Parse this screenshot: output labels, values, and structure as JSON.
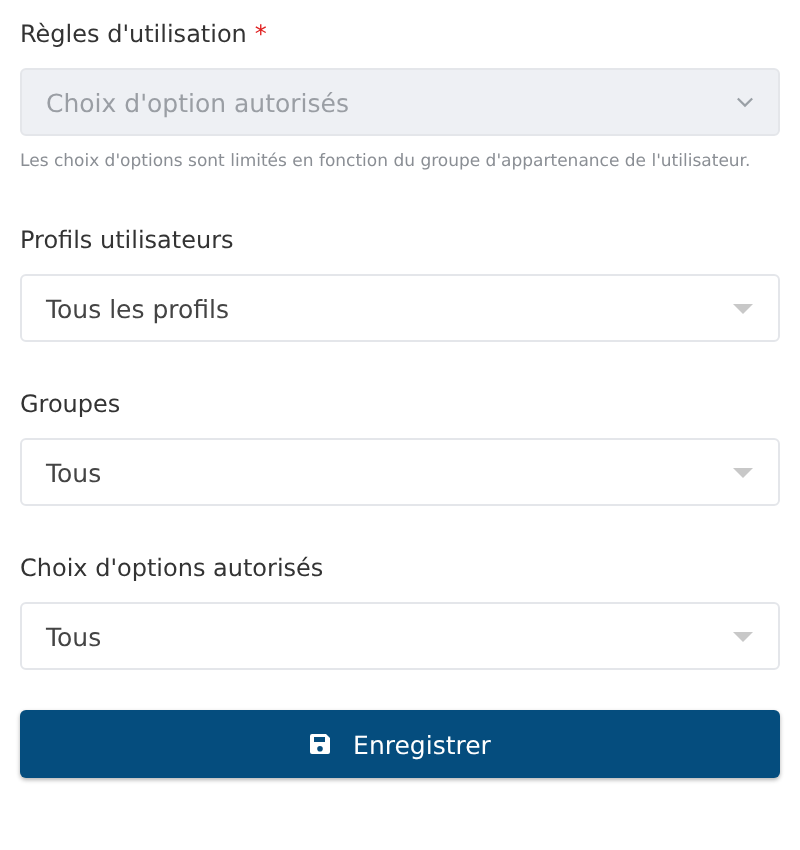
{
  "fields": [
    {
      "label": "Règles d'utilisation",
      "required_mark": "*",
      "value": "Choix d'option autorisés",
      "disabled": true,
      "kind": "chevron",
      "help": "Les choix d'options sont limités en fonction du groupe d'appartenance de l'utilisateur."
    },
    {
      "label": "Profils utilisateurs",
      "value": "Tous les profils",
      "disabled": false,
      "kind": "caret"
    },
    {
      "label": "Groupes",
      "value": "Tous",
      "disabled": false,
      "kind": "caret"
    },
    {
      "label": "Choix d'options autorisés",
      "value": "Tous",
      "disabled": false,
      "kind": "caret"
    }
  ],
  "button": {
    "label": "Enregistrer"
  }
}
